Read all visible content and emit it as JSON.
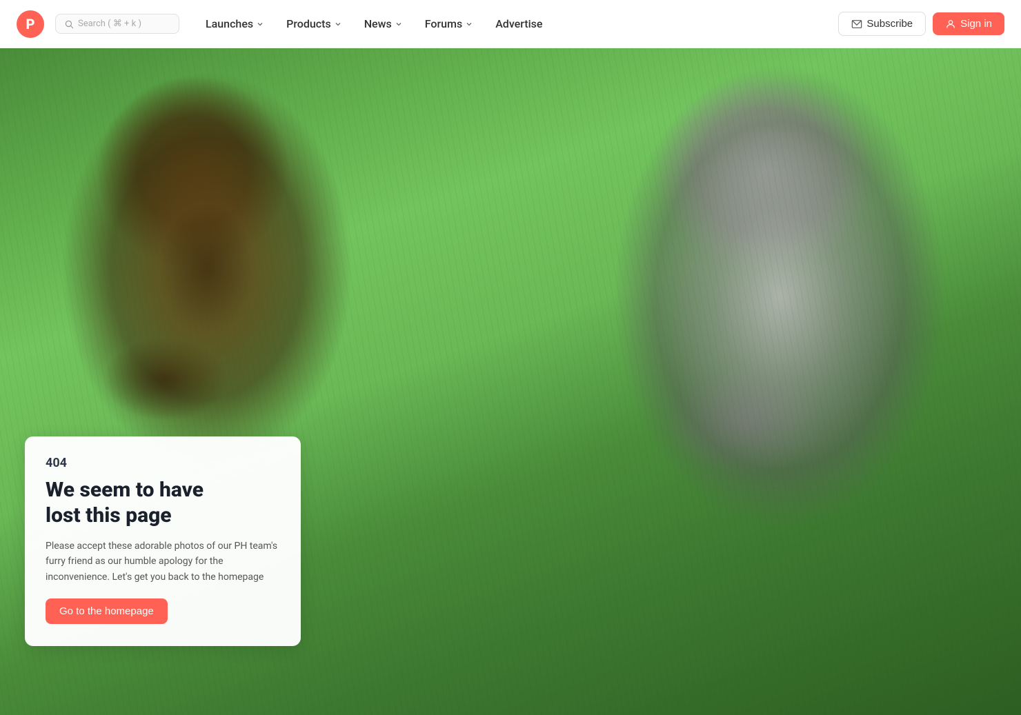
{
  "navbar": {
    "logo_letter": "P",
    "search_placeholder": "Search ( ⌘ + k )",
    "nav_items": [
      {
        "id": "launches",
        "label": "Launches",
        "has_dropdown": true
      },
      {
        "id": "products",
        "label": "Products",
        "has_dropdown": true
      },
      {
        "id": "news",
        "label": "News",
        "has_dropdown": true
      },
      {
        "id": "forums",
        "label": "Forums",
        "has_dropdown": true
      },
      {
        "id": "advertise",
        "label": "Advertise",
        "has_dropdown": false
      }
    ],
    "subscribe_label": "Subscribe",
    "signin_label": "Sign in"
  },
  "error": {
    "code": "404",
    "title_line1": "We seem to have",
    "title_line2": "lost this page",
    "description": "Please accept these adorable photos of our PH team's furry friend as our humble apology for the inconvenience. Let's get you back to the homepage",
    "cta_label": "Go to the homepage"
  },
  "colors": {
    "accent": "#ff6154",
    "text_dark": "#1a202c",
    "text_muted": "#555"
  }
}
